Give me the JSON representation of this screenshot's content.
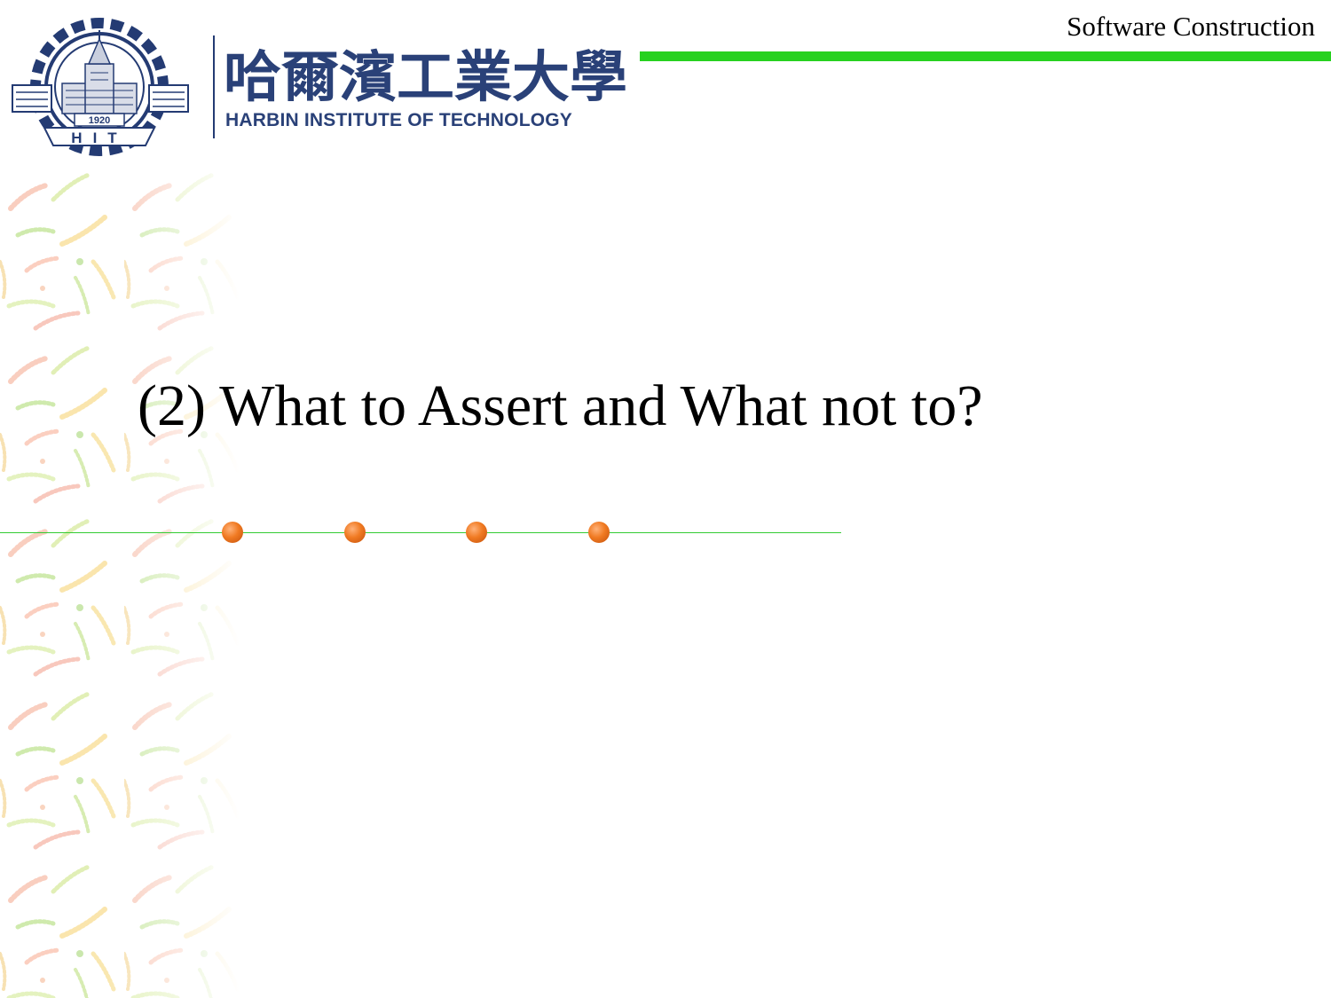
{
  "header": {
    "course_title": "Software Construction",
    "accent_color": "#27d11f"
  },
  "logo": {
    "chinese_name": "哈爾濱工業大學",
    "english_name": "HARBIN INSTITUTE OF TECHNOLOGY",
    "emblem_year": "1920",
    "emblem_letters": "HIT",
    "brand_color": "#243b73"
  },
  "slide": {
    "title": "(2) What to Assert and What not to?"
  },
  "decoration": {
    "dot_count": 4,
    "dot_color": "#f07a22",
    "line_color": "#33cc33"
  }
}
